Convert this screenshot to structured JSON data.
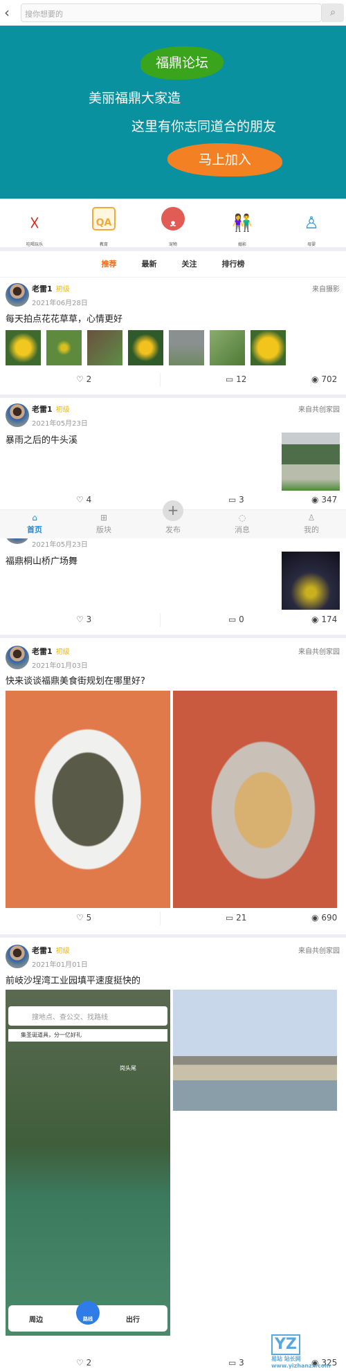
{
  "header": {
    "search_placeholder": "搜你想要的",
    "back_icon": "chevron-left-icon",
    "search_icon": "search-icon"
  },
  "banner": {
    "title": "福鼎论坛",
    "line1": "美丽福鼎大家造",
    "line2": "这里有你志同道合的朋友",
    "cta": "马上加入",
    "bg": "#0a91a0",
    "title_bg": "#3aa51c",
    "cta_bg": "#f38124"
  },
  "categories": [
    {
      "label": "吃喝玩乐",
      "icon": "person-jump-icon",
      "color": "#d42a1a"
    },
    {
      "label": "教育",
      "icon": "qa-icon",
      "color": "#f2a93b"
    },
    {
      "label": "宠物",
      "icon": "cat-icon",
      "color": "#e35b55"
    },
    {
      "label": "婚影",
      "icon": "couple-icon",
      "color": "#f08a3c"
    },
    {
      "label": "母婴",
      "icon": "mother-baby-icon",
      "color": "#2a9bd4"
    }
  ],
  "tabs": [
    {
      "label": "推荐",
      "active": true
    },
    {
      "label": "最新"
    },
    {
      "label": "关注"
    },
    {
      "label": "排行榜"
    }
  ],
  "posts": [
    {
      "author": "老雷1",
      "level": "初级",
      "date": "2021年06月28日",
      "source": "来自摄影",
      "title": "每天拍点花花草草，心情更好",
      "likes": "2",
      "comments": "12",
      "views": "702"
    },
    {
      "author": "老雷1",
      "level": "初级",
      "date": "2021年05月23日",
      "source": "来自共创家园",
      "title": "暴雨之后的牛头溪",
      "likes": "4",
      "comments": "3",
      "views": "347"
    },
    {
      "date": "2021年05月23日",
      "title": "福鼎桐山桥广场舞",
      "likes": "3",
      "comments": "0",
      "views": "174"
    },
    {
      "author": "老雷1",
      "level": "初级",
      "date": "2021年01月03日",
      "source": "来自共创家园",
      "title": "快来谈谈福鼎美食街规划在哪里好?",
      "likes": "5",
      "comments": "21",
      "views": "690"
    },
    {
      "author": "老雷1",
      "level": "初级",
      "date": "2021年01月01日",
      "source": "来自共创家园",
      "title": "前岐沙埕湾工业园填平速度挺快的",
      "likes": "2",
      "comments": "3",
      "views": "325"
    }
  ],
  "map_screenshot": {
    "search": "搜地点、查公交、找路线",
    "notice": "集圣诞道具，分一亿好礼",
    "poi": "岗头尾",
    "nearby": "周边",
    "route": "路线",
    "travel": "出行"
  },
  "nav": [
    {
      "label": "首页",
      "icon": "home-icon",
      "active": true
    },
    {
      "label": "版块",
      "icon": "grid-icon"
    },
    {
      "label": "发布",
      "icon": "plus-icon"
    },
    {
      "label": "消息",
      "icon": "message-icon"
    },
    {
      "label": "我的",
      "icon": "user-icon"
    }
  ],
  "watermark": {
    "text": "易站 站长网 www.yizhanzx.com"
  },
  "colors": {
    "accent": "#f26b1d",
    "nav_active": "#1e88e5",
    "level": "#f5b800"
  }
}
